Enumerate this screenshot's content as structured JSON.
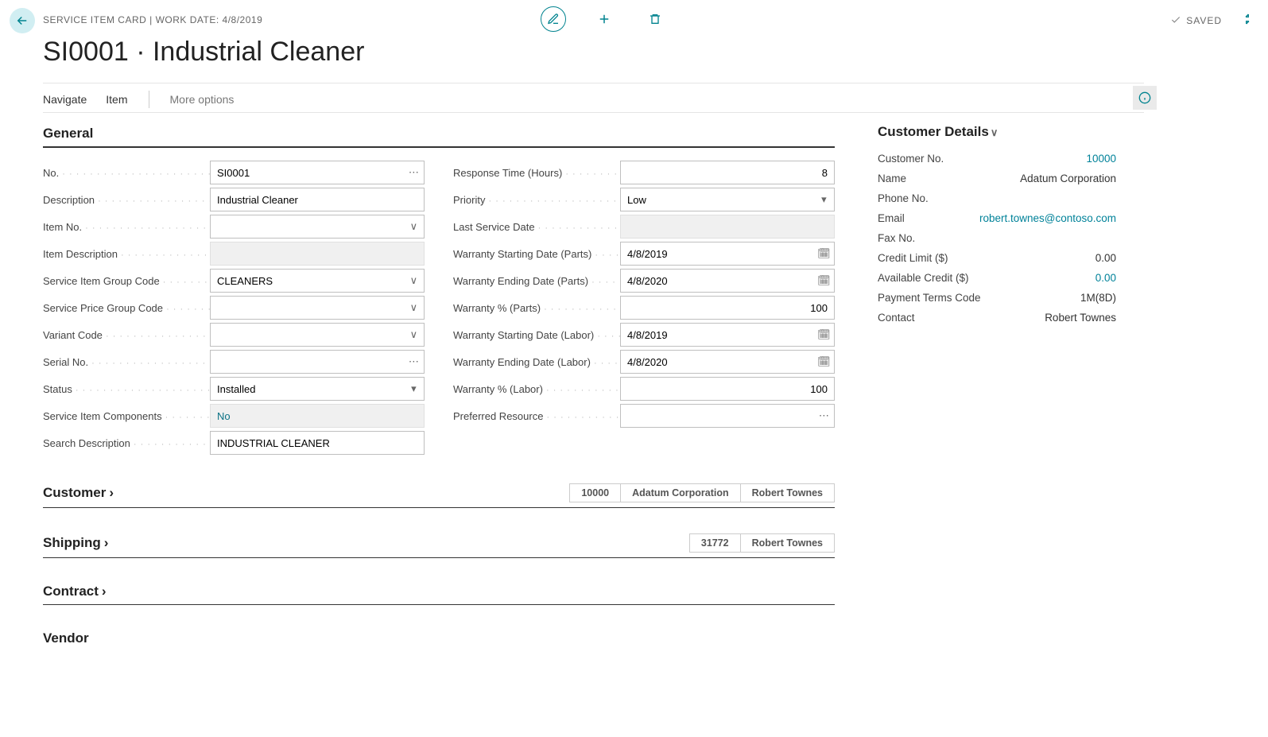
{
  "breadcrumb": "SERVICE ITEM CARD | WORK DATE: 4/8/2019",
  "saved_label": "SAVED",
  "title": "SI0001 · Industrial Cleaner",
  "menu": {
    "navigate": "Navigate",
    "item": "Item",
    "more": "More options"
  },
  "general": {
    "header": "General",
    "no": {
      "label": "No.",
      "value": "SI0001"
    },
    "description": {
      "label": "Description",
      "value": "Industrial Cleaner"
    },
    "item_no": {
      "label": "Item No.",
      "value": ""
    },
    "item_description": {
      "label": "Item Description",
      "value": ""
    },
    "service_item_group_code": {
      "label": "Service Item Group Code",
      "value": "CLEANERS"
    },
    "service_price_group_code": {
      "label": "Service Price Group Code",
      "value": ""
    },
    "variant_code": {
      "label": "Variant Code",
      "value": ""
    },
    "serial_no": {
      "label": "Serial No.",
      "value": ""
    },
    "status": {
      "label": "Status",
      "value": "Installed"
    },
    "service_item_components": {
      "label": "Service Item Components",
      "value": "No"
    },
    "search_description": {
      "label": "Search Description",
      "value": "INDUSTRIAL CLEANER"
    },
    "response_time": {
      "label": "Response Time (Hours)",
      "value": "8"
    },
    "priority": {
      "label": "Priority",
      "value": "Low"
    },
    "last_service_date": {
      "label": "Last Service Date",
      "value": ""
    },
    "warranty_start_parts": {
      "label": "Warranty Starting Date (Parts)",
      "value": "4/8/2019"
    },
    "warranty_end_parts": {
      "label": "Warranty Ending Date (Parts)",
      "value": "4/8/2020"
    },
    "warranty_pct_parts": {
      "label": "Warranty % (Parts)",
      "value": "100"
    },
    "warranty_start_labor": {
      "label": "Warranty Starting Date (Labor)",
      "value": "4/8/2019"
    },
    "warranty_end_labor": {
      "label": "Warranty Ending Date (Labor)",
      "value": "4/8/2020"
    },
    "warranty_pct_labor": {
      "label": "Warranty % (Labor)",
      "value": "100"
    },
    "preferred_resource": {
      "label": "Preferred Resource",
      "value": ""
    }
  },
  "customer_section": {
    "header": "Customer",
    "summary": [
      "10000",
      "Adatum Corporation",
      "Robert Townes"
    ]
  },
  "shipping_section": {
    "header": "Shipping",
    "summary": [
      "31772",
      "Robert Townes"
    ]
  },
  "contract_section": {
    "header": "Contract"
  },
  "vendor_section": {
    "header": "Vendor"
  },
  "customer_details": {
    "header": "Customer Details",
    "customer_no": {
      "label": "Customer No.",
      "value": "10000"
    },
    "name": {
      "label": "Name",
      "value": "Adatum Corporation"
    },
    "phone_no": {
      "label": "Phone No.",
      "value": ""
    },
    "email": {
      "label": "Email",
      "value": "robert.townes@contoso.com"
    },
    "fax_no": {
      "label": "Fax No.",
      "value": ""
    },
    "credit_limit": {
      "label": "Credit Limit ($)",
      "value": "0.00"
    },
    "available_credit": {
      "label": "Available Credit ($)",
      "value": "0.00"
    },
    "payment_terms": {
      "label": "Payment Terms Code",
      "value": "1M(8D)"
    },
    "contact": {
      "label": "Contact",
      "value": "Robert Townes"
    }
  }
}
